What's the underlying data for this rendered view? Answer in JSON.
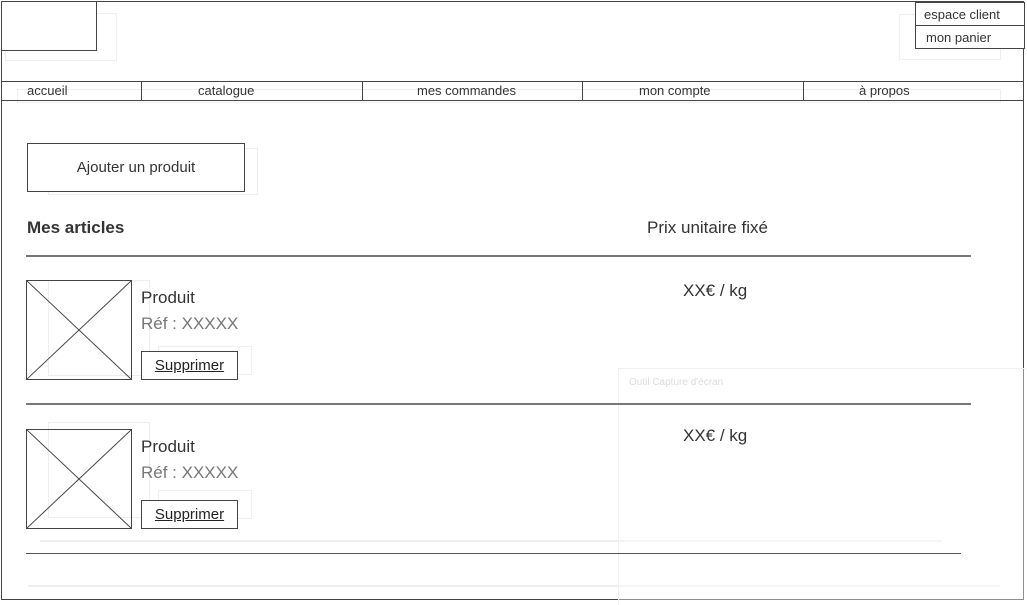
{
  "header": {
    "espace_client": "espace client",
    "mon_panier": "mon panier"
  },
  "nav": {
    "items": [
      {
        "label": "accueil"
      },
      {
        "label": "catalogue"
      },
      {
        "label": "mes commandes"
      },
      {
        "label": "mon compte"
      },
      {
        "label": "à propos"
      }
    ]
  },
  "main": {
    "add_button": "Ajouter un produit",
    "col_articles": "Mes articles",
    "col_price": "Prix unitaire fixé",
    "products": [
      {
        "name": "Produit",
        "ref": "Réf : XXXXX",
        "delete_label": "Supprimer",
        "price": "XX€ / kg"
      },
      {
        "name": "Produit",
        "ref": "Réf : XXXXX",
        "delete_label": "Supprimer",
        "price": "XX€ / kg"
      }
    ]
  },
  "overlay": {
    "ghost_window_title": "Outil Capture d'écran"
  },
  "colors": {
    "line": "#444444",
    "text": "#333333",
    "muted": "#777777"
  }
}
